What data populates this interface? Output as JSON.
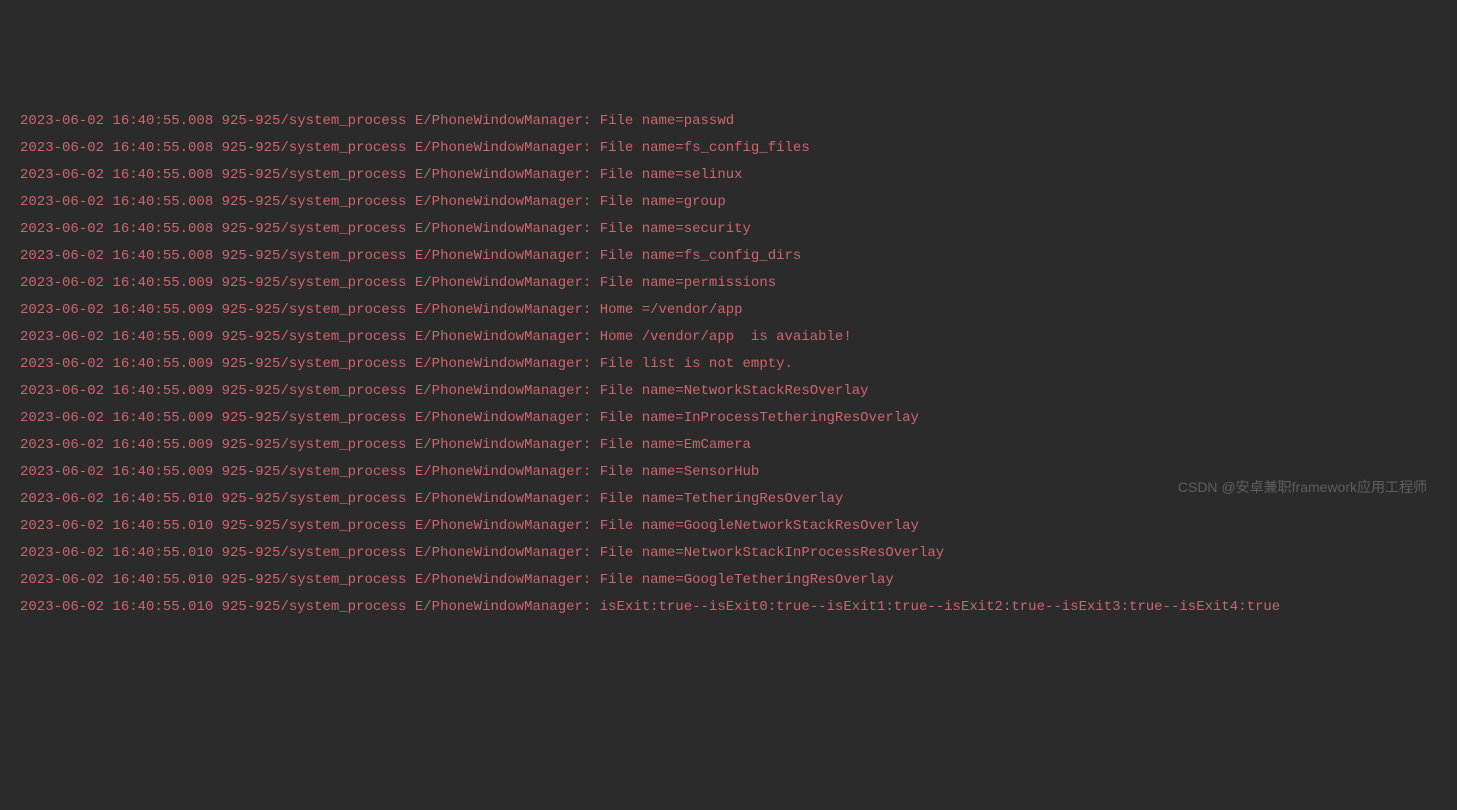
{
  "logs": [
    {
      "timestamp": "2023-06-02 16:40:55.008",
      "pid_tid": "925-925",
      "process": "system_process",
      "level": "E",
      "tag": "PhoneWindowManager",
      "message": "File name=passwd"
    },
    {
      "timestamp": "2023-06-02 16:40:55.008",
      "pid_tid": "925-925",
      "process": "system_process",
      "level": "E",
      "tag": "PhoneWindowManager",
      "message": "File name=fs_config_files"
    },
    {
      "timestamp": "2023-06-02 16:40:55.008",
      "pid_tid": "925-925",
      "process": "system_process",
      "level": "E",
      "tag": "PhoneWindowManager",
      "message": "File name=selinux"
    },
    {
      "timestamp": "2023-06-02 16:40:55.008",
      "pid_tid": "925-925",
      "process": "system_process",
      "level": "E",
      "tag": "PhoneWindowManager",
      "message": "File name=group"
    },
    {
      "timestamp": "2023-06-02 16:40:55.008",
      "pid_tid": "925-925",
      "process": "system_process",
      "level": "E",
      "tag": "PhoneWindowManager",
      "message": "File name=security"
    },
    {
      "timestamp": "2023-06-02 16:40:55.008",
      "pid_tid": "925-925",
      "process": "system_process",
      "level": "E",
      "tag": "PhoneWindowManager",
      "message": "File name=fs_config_dirs"
    },
    {
      "timestamp": "2023-06-02 16:40:55.009",
      "pid_tid": "925-925",
      "process": "system_process",
      "level": "E",
      "tag": "PhoneWindowManager",
      "message": "File name=permissions"
    },
    {
      "timestamp": "2023-06-02 16:40:55.009",
      "pid_tid": "925-925",
      "process": "system_process",
      "level": "E",
      "tag": "PhoneWindowManager",
      "message": "Home =/vendor/app"
    },
    {
      "timestamp": "2023-06-02 16:40:55.009",
      "pid_tid": "925-925",
      "process": "system_process",
      "level": "E",
      "tag": "PhoneWindowManager",
      "message": "Home /vendor/app  is avaiable!"
    },
    {
      "timestamp": "2023-06-02 16:40:55.009",
      "pid_tid": "925-925",
      "process": "system_process",
      "level": "E",
      "tag": "PhoneWindowManager",
      "message": "File list is not empty."
    },
    {
      "timestamp": "2023-06-02 16:40:55.009",
      "pid_tid": "925-925",
      "process": "system_process",
      "level": "E",
      "tag": "PhoneWindowManager",
      "message": "File name=NetworkStackResOverlay"
    },
    {
      "timestamp": "2023-06-02 16:40:55.009",
      "pid_tid": "925-925",
      "process": "system_process",
      "level": "E",
      "tag": "PhoneWindowManager",
      "message": "File name=InProcessTetheringResOverlay"
    },
    {
      "timestamp": "2023-06-02 16:40:55.009",
      "pid_tid": "925-925",
      "process": "system_process",
      "level": "E",
      "tag": "PhoneWindowManager",
      "message": "File name=EmCamera"
    },
    {
      "timestamp": "2023-06-02 16:40:55.009",
      "pid_tid": "925-925",
      "process": "system_process",
      "level": "E",
      "tag": "PhoneWindowManager",
      "message": "File name=SensorHub"
    },
    {
      "timestamp": "2023-06-02 16:40:55.010",
      "pid_tid": "925-925",
      "process": "system_process",
      "level": "E",
      "tag": "PhoneWindowManager",
      "message": "File name=TetheringResOverlay"
    },
    {
      "timestamp": "2023-06-02 16:40:55.010",
      "pid_tid": "925-925",
      "process": "system_process",
      "level": "E",
      "tag": "PhoneWindowManager",
      "message": "File name=GoogleNetworkStackResOverlay"
    },
    {
      "timestamp": "2023-06-02 16:40:55.010",
      "pid_tid": "925-925",
      "process": "system_process",
      "level": "E",
      "tag": "PhoneWindowManager",
      "message": "File name=NetworkStackInProcessResOverlay"
    },
    {
      "timestamp": "2023-06-02 16:40:55.010",
      "pid_tid": "925-925",
      "process": "system_process",
      "level": "E",
      "tag": "PhoneWindowManager",
      "message": "File name=GoogleTetheringResOverlay"
    },
    {
      "timestamp": "2023-06-02 16:40:55.010",
      "pid_tid": "925-925",
      "process": "system_process",
      "level": "E",
      "tag": "PhoneWindowManager",
      "message": "isExit:true--isExit0:true--isExit1:true--isExit2:true--isExit3:true--isExit4:true"
    }
  ],
  "watermark": "CSDN @安卓兼职framework应用工程师"
}
